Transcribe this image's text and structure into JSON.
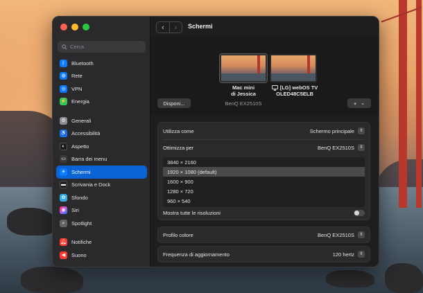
{
  "window": {
    "title": "Schermi"
  },
  "search": {
    "placeholder": "Cerca"
  },
  "sidebar": {
    "items": [
      {
        "label": "Bluetooth",
        "icon": "bluetooth-icon",
        "color": "#0a7aff"
      },
      {
        "label": "Rete",
        "icon": "globe-icon",
        "color": "#0a7aff"
      },
      {
        "label": "VPN",
        "icon": "vpn-icon",
        "color": "#0a7aff"
      },
      {
        "label": "Energia",
        "icon": "battery-icon",
        "color": "#34c759"
      },
      {
        "label": "Generali",
        "icon": "gear-icon",
        "color": "#8e8e93"
      },
      {
        "label": "Accessibilità",
        "icon": "accessibility-icon",
        "color": "#0a7aff"
      },
      {
        "label": "Aspetto",
        "icon": "appearance-icon",
        "color": "#1c1c1e"
      },
      {
        "label": "Barra dei menu",
        "icon": "menubar-icon",
        "color": "#3a3a3c"
      },
      {
        "label": "Schermi",
        "icon": "sun-icon",
        "color": "#0a7aff"
      },
      {
        "label": "Scrivania e Dock",
        "icon": "dock-icon",
        "color": "#1c1c1e"
      },
      {
        "label": "Sfondo",
        "icon": "wallpaper-icon",
        "color": "#32ade6"
      },
      {
        "label": "Siri",
        "icon": "siri-icon",
        "color": "#bf5af2"
      },
      {
        "label": "Spotlight",
        "icon": "spotlight-icon",
        "color": "#636366"
      },
      {
        "label": "Notifiche",
        "icon": "bell-icon",
        "color": "#ff3b30"
      },
      {
        "label": "Suono",
        "icon": "speaker-icon",
        "color": "#ff3b30"
      }
    ]
  },
  "displays": {
    "mac_label_1": "Mac mini",
    "mac_label_2": "di Jessica",
    "tv_label_1": "[LG] webOS TV",
    "tv_label_2": "OLED48C5ELB",
    "selected_sub": "BenQ EX2510S",
    "arrange_button": "Disponi...",
    "add_button": "+",
    "add_chevron": "⌄"
  },
  "settings": {
    "use_as_label": "Utilizza come",
    "use_as_value": "Schermo principale",
    "optimize_label": "Ottimizza per",
    "optimize_value": "BenQ EX2510S",
    "resolutions": [
      "3840 × 2160",
      "1920 × 1080 (default)",
      "1600 × 900",
      "1280 × 720",
      "960 × 540"
    ],
    "selected_resolution_index": 1,
    "show_all_label": "Mostra tutte le risoluzioni",
    "show_all_on": false,
    "color_profile_label": "Profilo colore",
    "color_profile_value": "BenQ EX2510S",
    "refresh_label": "Frequenza di aggiornamento",
    "refresh_value": "120 hertz"
  }
}
